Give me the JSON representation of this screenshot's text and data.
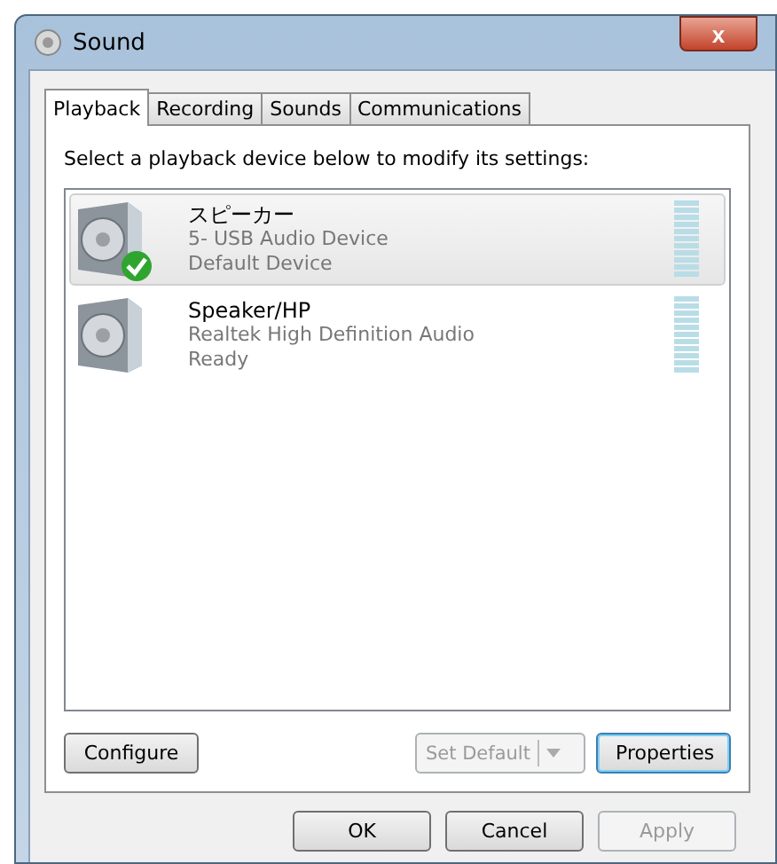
{
  "window": {
    "title": "Sound",
    "close": "x"
  },
  "tabs": [
    {
      "label": "Playback",
      "selected": true
    },
    {
      "label": "Recording",
      "selected": false
    },
    {
      "label": "Sounds",
      "selected": false
    },
    {
      "label": "Communications",
      "selected": false
    }
  ],
  "instruction": "Select a playback device below to modify its settings:",
  "devices": [
    {
      "name": "スピーカー",
      "description": "5- USB Audio Device",
      "status": "Default Device",
      "selected": true,
      "default": true
    },
    {
      "name": "Speaker/HP",
      "description": "Realtek High Definition Audio",
      "status": "Ready",
      "selected": false,
      "default": false
    }
  ],
  "list_buttons": [
    {
      "label": "Configure",
      "kind": "plain",
      "disabled": false,
      "focused": false
    },
    {
      "label": "Set Default",
      "kind": "split",
      "disabled": true,
      "focused": false
    },
    {
      "label": "Properties",
      "kind": "plain",
      "disabled": false,
      "focused": true
    }
  ],
  "dialog_buttons": [
    {
      "label": "OK",
      "disabled": false
    },
    {
      "label": "Cancel",
      "disabled": false
    },
    {
      "label": "Apply",
      "disabled": true
    }
  ]
}
